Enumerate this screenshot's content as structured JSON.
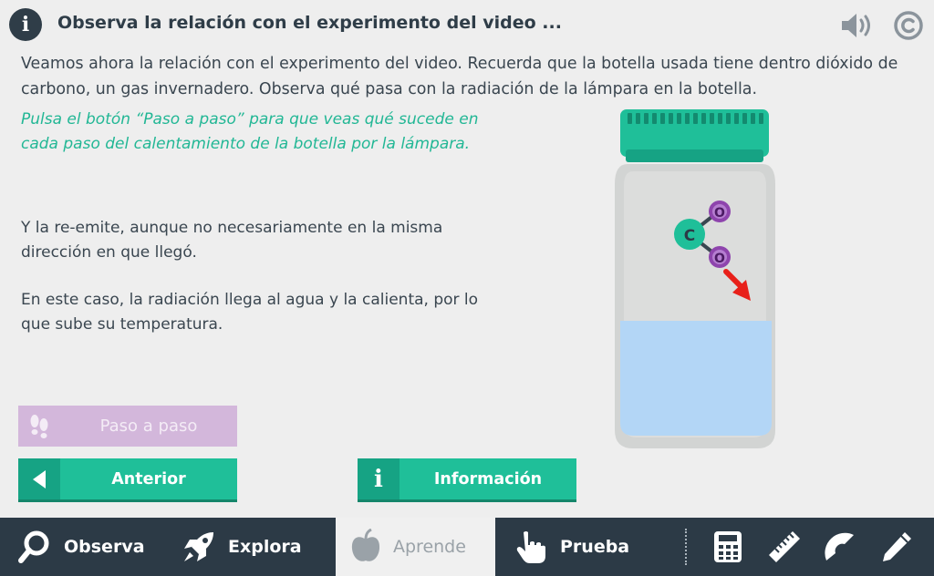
{
  "header": {
    "info_glyph": "i",
    "title": "Observa la relación con el experimento del video ...",
    "icons": [
      "sound-icon",
      "copyright-icon"
    ]
  },
  "intro": "Veamos ahora la relación con el experimento del video. Recuerda que la botella usada tiene dentro dióxido de carbono, un gas invernadero. Observa qué pasa con la radiación de la lámpara en la botella.",
  "hint": "Pulsa el botón “Paso a paso” para que veas qué sucede en cada paso del calentamiento de la botella por la lámpara.",
  "paragraphs": [
    "Y la re-emite, aunque no necesariamente en la misma dirección en que llegó.",
    "En este caso, la radiación llega al agua y la calienta, por lo que sube su temperatura."
  ],
  "buttons": {
    "step": "Paso a paso",
    "previous": "Anterior",
    "info": "Información",
    "info_glyph": "i"
  },
  "molecule": {
    "center": "C",
    "top": "O",
    "bottom": "O"
  },
  "colors": {
    "accent": "#1fbf99",
    "hint_text": "#22b795",
    "step_button": "#d3b7db",
    "navbar": "#2c3a46",
    "water": "#b3d6f6",
    "arrow": "#e8201a",
    "carbon": "#1fbf99",
    "oxygen": "#8e44ad"
  },
  "nav": {
    "items": [
      {
        "label": "Observa",
        "icon": "search-icon"
      },
      {
        "label": "Explora",
        "icon": "rocket-icon"
      },
      {
        "label": "Aprende",
        "icon": "apple-icon",
        "active": true
      },
      {
        "label": "Prueba",
        "icon": "hand-pointer-icon"
      }
    ],
    "tools": [
      "calculator-icon",
      "ruler-icon",
      "protractor-icon",
      "pencil-icon"
    ]
  }
}
